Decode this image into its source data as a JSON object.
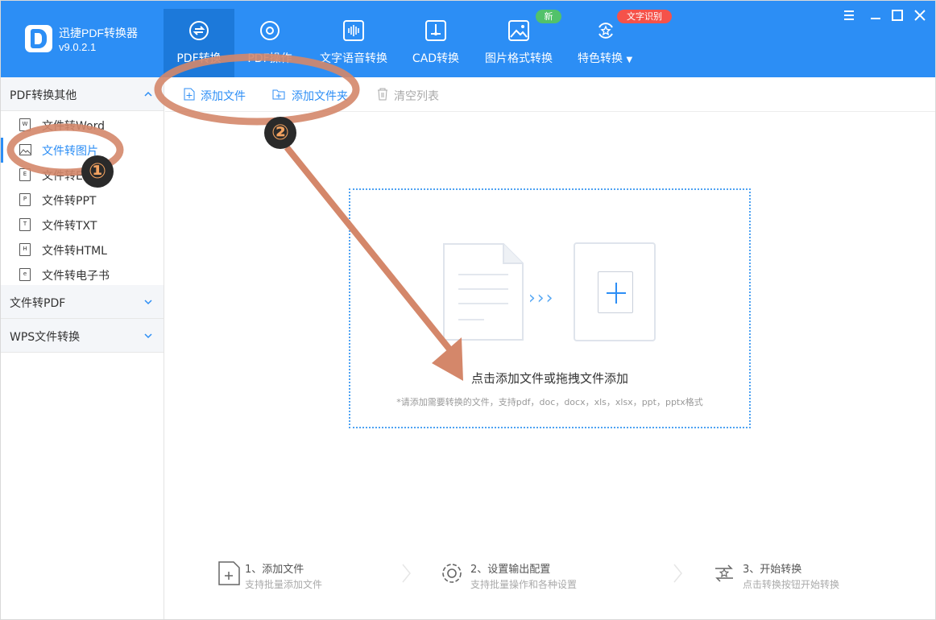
{
  "app": {
    "name": "迅捷PDF转换器",
    "version": "v9.0.2.1"
  },
  "tabs": [
    {
      "label": "PDF转换",
      "icon": "convert-icon",
      "active": true
    },
    {
      "label": "PDF操作",
      "icon": "gear-icon"
    },
    {
      "label": "文字语音转换",
      "icon": "audio-wave-icon"
    },
    {
      "label": "CAD转换",
      "icon": "cad-icon"
    },
    {
      "label": "图片格式转换",
      "icon": "image-icon"
    },
    {
      "label": "特色转换",
      "icon": "star-convert-icon"
    }
  ],
  "badges": {
    "new": "新",
    "ocr": "文字识别"
  },
  "sidebar": {
    "group1": "PDF转换其他",
    "items": [
      {
        "label": "文件转Word",
        "tag": "W"
      },
      {
        "label": "文件转图片",
        "tag": "img",
        "selected": true
      },
      {
        "label": "文件转Excel",
        "tag": "E"
      },
      {
        "label": "文件转PPT",
        "tag": "P"
      },
      {
        "label": "文件转TXT",
        "tag": "T"
      },
      {
        "label": "文件转HTML",
        "tag": "H"
      },
      {
        "label": "文件转电子书",
        "tag": "e"
      }
    ],
    "group2": "文件转PDF",
    "group3": "WPS文件转换"
  },
  "toolbar": {
    "add_file": "添加文件",
    "add_folder": "添加文件夹",
    "clear": "清空列表"
  },
  "dropzone": {
    "title": "点击添加文件或拖拽文件添加",
    "hint": "*请添加需要转换的文件，支持pdf，doc，docx，xls，xlsx，ppt，pptx格式"
  },
  "steps": [
    {
      "title": "1、添加文件",
      "desc": "支持批量添加文件"
    },
    {
      "title": "2、设置输出配置",
      "desc": "支持批量操作和各种设置"
    },
    {
      "title": "3、开始转换",
      "desc": "点击转换按钮开始转换"
    }
  ],
  "annotations": {
    "n1": "①",
    "n2": "②"
  },
  "colors": {
    "brand": "#2c8ef5",
    "annotation": "#d4876a"
  }
}
